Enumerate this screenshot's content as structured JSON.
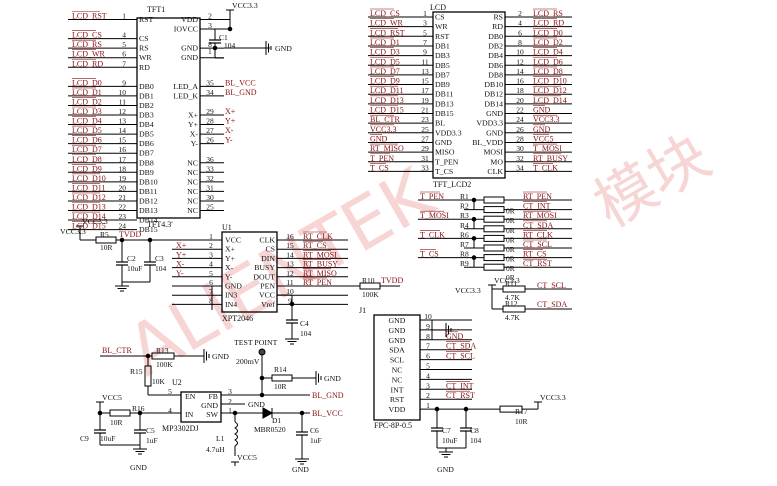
{
  "watermark": {
    "left": "ALIENTEK",
    "right": "模块"
  },
  "power": {
    "vcc33": "VCC3.3",
    "vcc5": "VCC5",
    "gnd": "GND"
  },
  "tft": {
    "ref": "TFT1",
    "name": "TFT4.3'",
    "left_pins": [
      {
        "num": "1",
        "pin": "RST",
        "net": "LCD_RST"
      },
      {
        "num": "4",
        "pin": "CS",
        "net": "LCD_CS"
      },
      {
        "num": "5",
        "pin": "RS",
        "net": "LCD_RS"
      },
      {
        "num": "6",
        "pin": "WR",
        "net": "LCD_WR"
      },
      {
        "num": "7",
        "pin": "RD",
        "net": "LCD_RD"
      },
      {
        "num": "9",
        "pin": "DB0",
        "net": "LCD_D0"
      },
      {
        "num": "10",
        "pin": "DB1",
        "net": "LCD_D1"
      },
      {
        "num": "11",
        "pin": "DB2",
        "net": "LCD_D2"
      },
      {
        "num": "12",
        "pin": "DB3",
        "net": "LCD_D3"
      },
      {
        "num": "13",
        "pin": "DB4",
        "net": "LCD_D4"
      },
      {
        "num": "14",
        "pin": "DB5",
        "net": "LCD_D5"
      },
      {
        "num": "15",
        "pin": "DB6",
        "net": "LCD_D6"
      },
      {
        "num": "16",
        "pin": "DB7",
        "net": "LCD_D7"
      },
      {
        "num": "17",
        "pin": "DB8",
        "net": "LCD_D8"
      },
      {
        "num": "18",
        "pin": "DB9",
        "net": "LCD_D9"
      },
      {
        "num": "19",
        "pin": "DB10",
        "net": "LCD_D10"
      },
      {
        "num": "20",
        "pin": "DB11",
        "net": "LCD_D11"
      },
      {
        "num": "21",
        "pin": "DB12",
        "net": "LCD_D12"
      },
      {
        "num": "22",
        "pin": "DB13",
        "net": "LCD_D13"
      },
      {
        "num": "23",
        "pin": "DB14",
        "net": "LCD_D14"
      },
      {
        "num": "24",
        "pin": "DB15",
        "net": "LCD_D15"
      }
    ],
    "right_pins": [
      {
        "num": "2",
        "pin": "VDD",
        "net": ""
      },
      {
        "num": "3",
        "pin": "IOVCC",
        "net": ""
      },
      {
        "num": "8",
        "pin": "GND",
        "net": ""
      },
      {
        "num": "",
        "pin": "GND",
        "net": ""
      },
      {
        "num": "",
        "pin": "",
        "net": ""
      },
      {
        "num": "35",
        "pin": "LED_A",
        "net": "BL_VCC"
      },
      {
        "num": "34",
        "pin": "LED_K",
        "net": "BL_GND"
      },
      {
        "num": "",
        "pin": "",
        "net": ""
      },
      {
        "num": "29",
        "pin": "X+",
        "net": "X+"
      },
      {
        "num": "28",
        "pin": "Y+",
        "net": "Y+"
      },
      {
        "num": "27",
        "pin": "X-",
        "net": "X-"
      },
      {
        "num": "26",
        "pin": "Y-",
        "net": "Y-"
      },
      {
        "num": "",
        "pin": "",
        "net": ""
      },
      {
        "num": "36",
        "pin": "NC",
        "net": ""
      },
      {
        "num": "33",
        "pin": "NC",
        "net": ""
      },
      {
        "num": "32",
        "pin": "NC",
        "net": ""
      },
      {
        "num": "31",
        "pin": "NC",
        "net": ""
      },
      {
        "num": "30",
        "pin": "NC",
        "net": ""
      },
      {
        "num": "25",
        "pin": "NC",
        "net": ""
      }
    ],
    "cap_ref": "C1",
    "cap_val": "104",
    "num_1": "1"
  },
  "lcd": {
    "ref": "LCD",
    "name": "TFT_LCD2",
    "rows": [
      {
        "ln": "LCD_CS",
        "lnum": "1",
        "lpin": "CS",
        "rpin": "RS",
        "rnum": "2",
        "rn": "LCD_RS"
      },
      {
        "ln": "LCD_WR",
        "lnum": "3",
        "lpin": "WR",
        "rpin": "RD",
        "rnum": "4",
        "rn": "LCD_RD"
      },
      {
        "ln": "LCD_RST",
        "lnum": "5",
        "lpin": "RST",
        "rpin": "DB0",
        "rnum": "6",
        "rn": "LCD_D0"
      },
      {
        "ln": "LCD_D1",
        "lnum": "7",
        "lpin": "DB1",
        "rpin": "DB2",
        "rnum": "8",
        "rn": "LCD_D2"
      },
      {
        "ln": "LCD_D3",
        "lnum": "9",
        "lpin": "DB3",
        "rpin": "DB4",
        "rnum": "10",
        "rn": "LCD_D4"
      },
      {
        "ln": "LCD_D5",
        "lnum": "11",
        "lpin": "DB5",
        "rpin": "DB6",
        "rnum": "12",
        "rn": "LCD_D6"
      },
      {
        "ln": "LCD_D7",
        "lnum": "13",
        "lpin": "DB7",
        "rpin": "DB8",
        "rnum": "14",
        "rn": "LCD_D8"
      },
      {
        "ln": "LCD_D9",
        "lnum": "15",
        "lpin": "DB9",
        "rpin": "DB10",
        "rnum": "16",
        "rn": "LCD_D10"
      },
      {
        "ln": "LCD_D11",
        "lnum": "17",
        "lpin": "DB11",
        "rpin": "DB12",
        "rnum": "18",
        "rn": "LCD_D12"
      },
      {
        "ln": "LCD_D13",
        "lnum": "19",
        "lpin": "DB13",
        "rpin": "DB14",
        "rnum": "20",
        "rn": "LCD_D14"
      },
      {
        "ln": "LCD_D15",
        "lnum": "21",
        "lpin": "DB15",
        "rpin": "GND",
        "rnum": "22",
        "rn": "GND"
      },
      {
        "ln": "BL_CTR",
        "lnum": "23",
        "lpin": "BL",
        "rpin": "VDD3.3",
        "rnum": "24",
        "rn": "VCC3.3"
      },
      {
        "ln": "VCC3.3",
        "lnum": "25",
        "lpin": "VDD3.3",
        "rpin": "GND",
        "rnum": "26",
        "rn": "GND"
      },
      {
        "ln": "GND",
        "lnum": "27",
        "lpin": "GND",
        "rpin": "BL_VDD",
        "rnum": "28",
        "rn": "VCC5"
      },
      {
        "ln": "RT_MISO",
        "lnum": "29",
        "lpin": "MISO",
        "rpin": "MOSI",
        "rnum": "30",
        "rn": "T_MOSI"
      },
      {
        "ln": "T_PEN",
        "lnum": "31",
        "lpin": "T_PEN",
        "rpin": "MO",
        "rnum": "32",
        "rn": "RT_BUSY"
      },
      {
        "ln": "T_CS",
        "lnum": "33",
        "lpin": "T_CS",
        "rpin": "CLK",
        "rnum": "34",
        "rn": "T_CLK"
      }
    ]
  },
  "rnet": {
    "rows": [
      {
        "l": "T_PEN",
        "ref": "R1",
        "v": "",
        "r": "RT_PEN"
      },
      {
        "l": "",
        "ref": "R2",
        "v": "0R",
        "r": "CT_INT"
      },
      {
        "l": "T_MOSI",
        "ref": "R3",
        "v": "0R",
        "r": "RT_MOSI"
      },
      {
        "l": "",
        "ref": "R4",
        "v": "0R",
        "r": "CT_SDA"
      },
      {
        "l": "T_CLK",
        "ref": "R6",
        "v": "0R",
        "r": "RT_CLK"
      },
      {
        "l": "",
        "ref": "R7",
        "v": "0R",
        "r": "CT_SCL"
      },
      {
        "l": "T_CS",
        "ref": "R8",
        "v": "0R",
        "r": "RT_CS"
      },
      {
        "l": "",
        "ref": "R9",
        "v": "0R",
        "r": "CT_RST"
      }
    ],
    "last_val": "0R",
    "vcc": "VCC3.3",
    "r11": "R11",
    "r11v": "4.7K",
    "r11n": "CT_SCL",
    "r12": "R12",
    "r12v": "4.7K",
    "r12n": "CT_SDA"
  },
  "u1": {
    "ref": "U1",
    "name": "XPT2046",
    "left": [
      {
        "num": "1",
        "pin": "VCC",
        "net": "TVDD"
      },
      {
        "num": "2",
        "pin": "X+",
        "net": "X+"
      },
      {
        "num": "3",
        "pin": "Y+",
        "net": "Y+"
      },
      {
        "num": "4",
        "pin": "X-",
        "net": "X-"
      },
      {
        "num": "5",
        "pin": "Y-",
        "net": "Y-"
      },
      {
        "num": "6",
        "pin": "GND",
        "net": ""
      },
      {
        "num": "7",
        "pin": "IN3",
        "net": ""
      },
      {
        "num": "8",
        "pin": "IN4",
        "net": ""
      }
    ],
    "right": [
      {
        "num": "16",
        "pin": "CLK",
        "net": "RT_CLK"
      },
      {
        "num": "15",
        "pin": "CS",
        "net": "RT_CS"
      },
      {
        "num": "14",
        "pin": "DIN",
        "net": "RT_MOSI"
      },
      {
        "num": "13",
        "pin": "BUSY",
        "net": "RT_BUSY"
      },
      {
        "num": "12",
        "pin": "DOUT",
        "net": "RT_MISO"
      },
      {
        "num": "11",
        "pin": "PEN",
        "net": "RT_PEN"
      },
      {
        "num": "10",
        "pin": "VCC",
        "net": ""
      },
      {
        "num": "9",
        "pin": "Vref",
        "net": ""
      }
    ],
    "vcc": "VCC3.3",
    "r5": "R5",
    "r5v": "10R",
    "tvdd": "TVDD",
    "c2": "C2",
    "c2v": "10uF",
    "c3": "C3",
    "c3v": "104",
    "r10": "R10",
    "r10v": "100K",
    "tvdd2": "TVDD",
    "c4": "C4",
    "c4v": "104"
  },
  "j1": {
    "ref": "J1",
    "name": "FPC-8P-0.5",
    "pins": [
      {
        "num": "10",
        "pin": "GND",
        "net": ""
      },
      {
        "num": "9",
        "pin": "GND",
        "net": ""
      },
      {
        "num": "8",
        "pin": "GND",
        "net": "GND"
      },
      {
        "num": "7",
        "pin": "SDA",
        "net": "CT_SDA"
      },
      {
        "num": "6",
        "pin": "SCL",
        "net": "CT_SCL"
      },
      {
        "num": "5",
        "pin": "NC",
        "net": ""
      },
      {
        "num": "4",
        "pin": "NC",
        "net": ""
      },
      {
        "num": "3",
        "pin": "INT",
        "net": "CT_INT"
      },
      {
        "num": "2",
        "pin": "RST",
        "net": "CT_RST"
      },
      {
        "num": "1",
        "pin": "VDD",
        "net": ""
      }
    ],
    "r17": "R17",
    "r17v": "10R",
    "vcc": "VCC3.3",
    "c7": "C7",
    "c7v": "10uF",
    "c8": "C8",
    "c8v": "104"
  },
  "u2": {
    "ref": "U2",
    "name": "MP3302DJ",
    "pins_left": [
      {
        "num": "5",
        "pin": "EN"
      },
      {
        "num": "",
        "pin": ""
      },
      {
        "num": "4",
        "pin": "IN"
      }
    ],
    "pins_right": [
      {
        "num": "3",
        "pin": "FB"
      },
      {
        "num": "2",
        "pin": "GND"
      },
      {
        "num": "1",
        "pin": "SW"
      }
    ],
    "bl_ctr": "BL_CTR",
    "r13": "R13",
    "r13v": "100K",
    "r15": "R15",
    "r15v": "10K",
    "vcc5": "VCC5",
    "r16": "R16",
    "r16v": "10R",
    "c9": "C9",
    "c9v": "10uF",
    "c5": "C5",
    "c5v": "1uF",
    "l1": "L1",
    "l1v": "4.7uH",
    "d1": "D1",
    "d1v": "MBR0520",
    "c6": "C6",
    "c6v": "1uF",
    "test_point": "TEST POINT",
    "tp_val": "200mV",
    "r14": "R14",
    "r14v": "10R",
    "bl_gnd": "BL_GND",
    "bl_vcc": "BL_VCC"
  }
}
